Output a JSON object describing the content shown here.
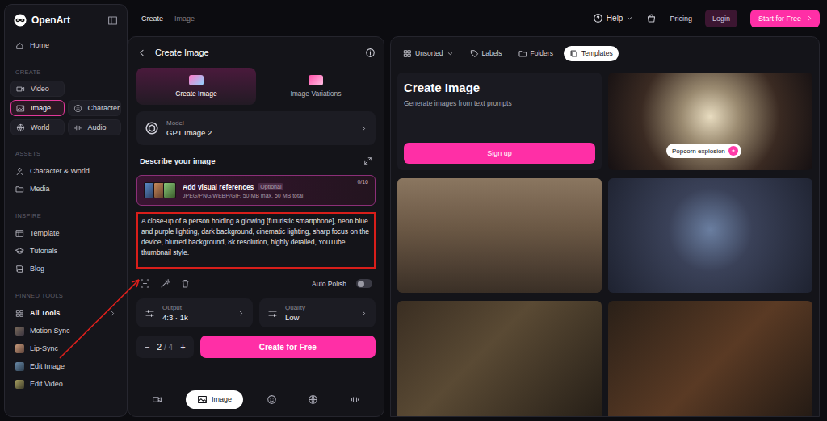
{
  "topbar": {
    "breadcrumb": [
      {
        "label": "Create",
        "selected": false
      },
      {
        "label": "Image",
        "selected": true
      }
    ],
    "help": "Help",
    "pricing": "Pricing",
    "login": "Login",
    "cta": "Start for Free"
  },
  "sidebar": {
    "logo": "OpenArt",
    "home": "Home",
    "sections": [
      {
        "title": "CREATE",
        "kind": "tiles",
        "items": [
          {
            "label": "Video",
            "selected": false
          },
          {
            "label": "Image",
            "selected": true
          },
          {
            "label": "Character",
            "selected": false
          },
          {
            "label": "World",
            "selected": false
          },
          {
            "label": "Audio",
            "selected": false
          }
        ]
      },
      {
        "title": "ASSETS",
        "kind": "list",
        "items": [
          {
            "label": "Character & World",
            "selected": false
          },
          {
            "label": "Media",
            "selected": false
          }
        ]
      },
      {
        "title": "INSPIRE",
        "kind": "list",
        "items": [
          {
            "label": "Template",
            "selected": false
          },
          {
            "label": "Tutorials",
            "selected": false
          },
          {
            "label": "Blog",
            "selected": false
          }
        ]
      }
    ],
    "pinned": {
      "title": "PINNED TOOLS",
      "items": [
        {
          "label": "All Tools",
          "kind": "group"
        },
        {
          "label": "Motion Sync",
          "kind": "tool"
        },
        {
          "label": "Lip-Sync",
          "kind": "tool"
        },
        {
          "label": "Edit Image",
          "kind": "tool"
        },
        {
          "label": "Edit Video",
          "kind": "tool"
        }
      ]
    }
  },
  "composer": {
    "title": "Create Image",
    "modes": [
      {
        "label": "Create Image",
        "selected": true
      },
      {
        "label": "Image Variations",
        "selected": false
      }
    ],
    "model": {
      "label": "Model",
      "value": "GPT Image 2"
    },
    "describe_title": "Describe your image",
    "references": {
      "title": "Add visual references",
      "badge": "Optional",
      "formats": "JPEG/PNG/WEBP/GIF, 50 MB max, 50 MB total",
      "count": "0/16"
    },
    "prompt": "A close-up of a person holding a glowing [futuristic smartphone], neon blue and purple lighting, dark background, cinematic lighting, sharp focus on the device, blurred background, 8k resolution, highly detailed, YouTube thumbnail style.",
    "auto_polish": {
      "label": "Auto Polish",
      "on": false
    },
    "output": {
      "label": "Output",
      "value": "4:3 · 1k"
    },
    "quality": {
      "label": "Quality",
      "value": "Low"
    },
    "counter": {
      "decrement": "−",
      "value": "2",
      "limit": "/ 4",
      "increment": "+"
    },
    "create_button": "Create for Free",
    "bottom_tabs": [
      {
        "kind": "video",
        "selected": false
      },
      {
        "kind": "image",
        "label": "Image",
        "selected": true
      },
      {
        "kind": "character",
        "selected": false
      },
      {
        "kind": "world",
        "selected": false
      },
      {
        "kind": "audio",
        "selected": false
      }
    ]
  },
  "gallery": {
    "toolbar": [
      {
        "label": "Unsorted",
        "kind": "dropdown",
        "selected": false
      },
      {
        "label": "Labels",
        "kind": "button",
        "selected": false
      },
      {
        "label": "Folders",
        "kind": "button",
        "selected": false
      },
      {
        "label": "Templates",
        "kind": "button",
        "selected": true
      }
    ],
    "intro": {
      "title": "Create Image",
      "subtitle": "Generate images from text prompts",
      "button": "Sign up"
    },
    "tiles": [
      {
        "kind": "captioned",
        "caption": "Popcorn explosion"
      },
      {
        "kind": "plain"
      },
      {
        "kind": "plain"
      },
      {
        "kind": "plain"
      },
      {
        "kind": "plain"
      }
    ]
  }
}
